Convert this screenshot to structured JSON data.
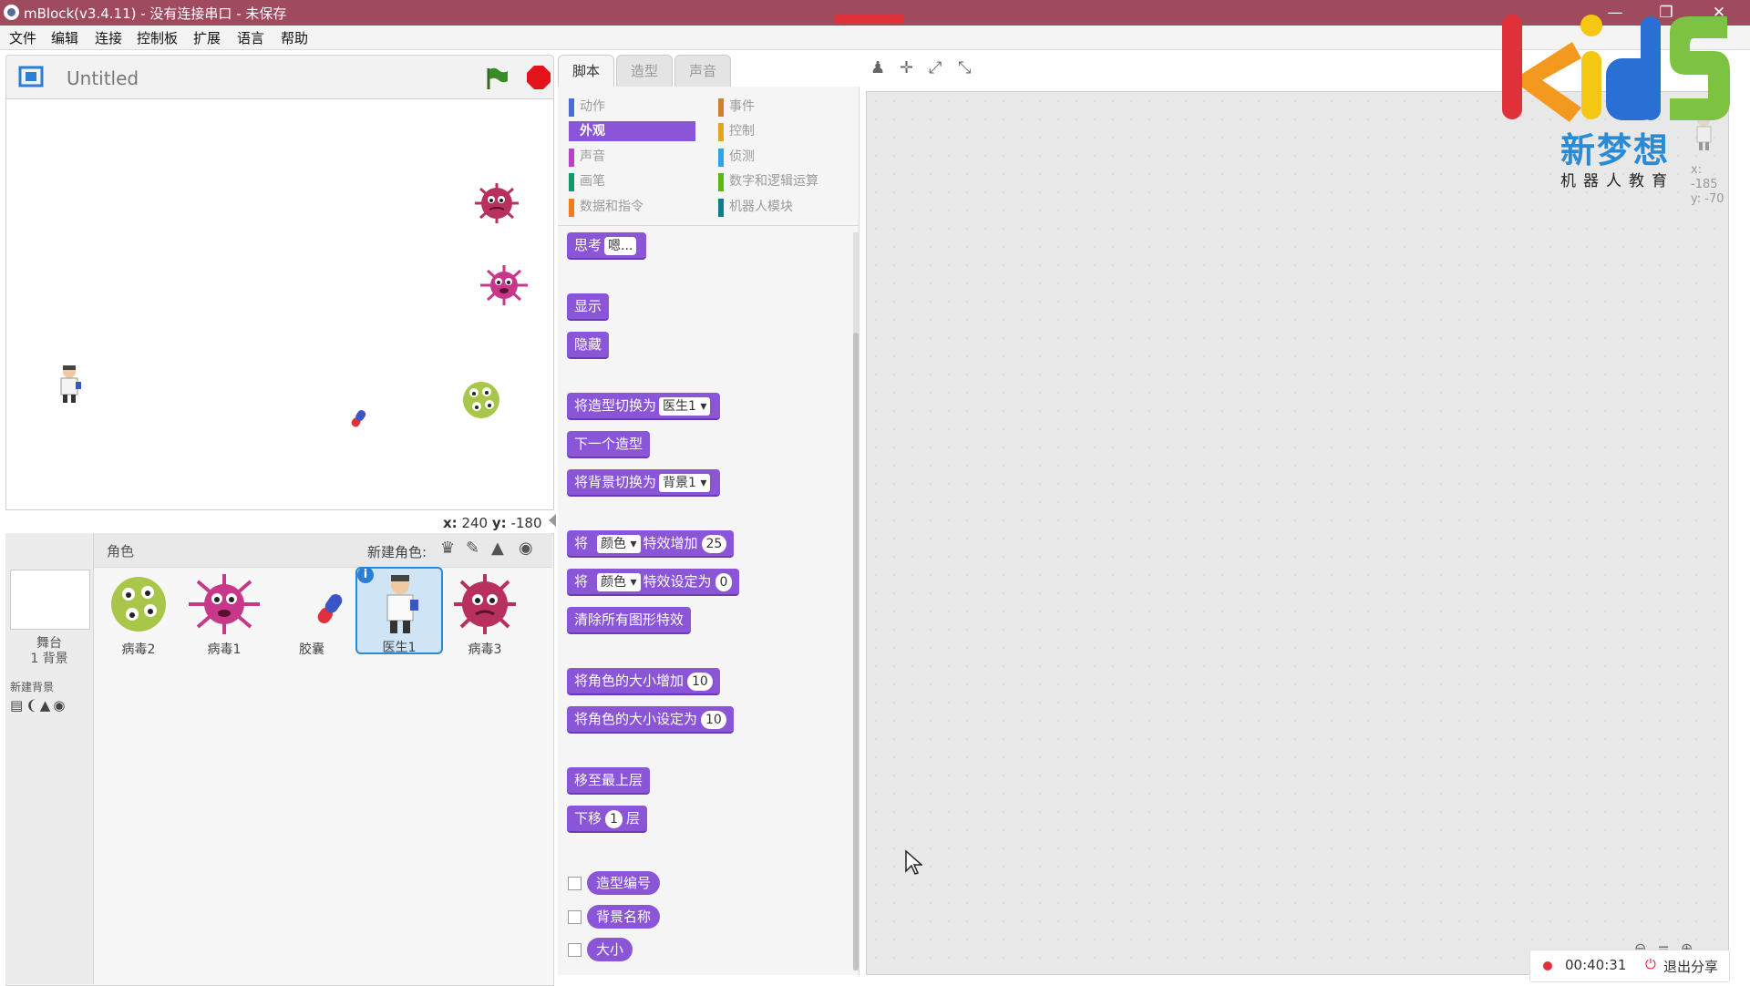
{
  "window": {
    "title": "mBlock(v3.4.11) - 没有连接串口 - 未保存"
  },
  "menu": [
    "文件",
    "编辑",
    "连接",
    "控制板",
    "扩展",
    "语言",
    "帮助"
  ],
  "stage": {
    "title": "Untitled",
    "coords": {
      "x_label": "x:",
      "x": "240",
      "y_label": "y:",
      "y": "-180"
    }
  },
  "sprites_panel": {
    "header": "角色",
    "new_sprite_label": "新建角色:",
    "stage_label": "舞台",
    "stage_backdrops": "1 背景",
    "new_backdrop_label": "新建背景",
    "sprites": [
      {
        "name": "病毒2",
        "color": "#a8c74a"
      },
      {
        "name": "病毒1",
        "color": "#c8388a"
      },
      {
        "name": "胶囊",
        "color": "#3a55c8"
      },
      {
        "name": "医生1",
        "color": "#ffffff",
        "selected": true
      },
      {
        "name": "病毒3",
        "color": "#b8305e"
      }
    ]
  },
  "tabs": [
    "脚本",
    "造型",
    "声音"
  ],
  "categories": [
    {
      "label": "动作",
      "color": "#4a6cd4"
    },
    {
      "label": "外观",
      "color": "#8a55d7",
      "selected": true
    },
    {
      "label": "声音",
      "color": "#bb42c3"
    },
    {
      "label": "画笔",
      "color": "#0e9a6c"
    },
    {
      "label": "数据和指令",
      "color": "#ee7d16"
    },
    {
      "label": "事件",
      "color": "#c88330"
    },
    {
      "label": "控制",
      "color": "#e1a91a"
    },
    {
      "label": "侦测",
      "color": "#2ca5e2"
    },
    {
      "label": "数字和逻辑运算",
      "color": "#5cb712"
    },
    {
      "label": "机器人模块",
      "color": "#0e7e8c"
    }
  ],
  "blocks": {
    "think": {
      "label": "思考",
      "arg": "嗯..."
    },
    "show": "显示",
    "hide": "隐藏",
    "switch_costume": {
      "label": "将造型切换为",
      "arg": "医生1"
    },
    "next_costume": "下一个造型",
    "switch_backdrop": {
      "label": "将背景切换为",
      "arg": "背景1"
    },
    "change_effect": {
      "pre": "将",
      "effect": "颜色",
      "label": "特效增加",
      "arg": "25"
    },
    "set_effect": {
      "pre": "将",
      "effect": "颜色",
      "label": "特效设定为",
      "arg": "0"
    },
    "clear_effects": "清除所有图形特效",
    "change_size": {
      "label": "将角色的大小增加",
      "arg": "10"
    },
    "set_size": {
      "label": "将角色的大小设定为",
      "arg": "10"
    },
    "front": "移至最上层",
    "back": {
      "pre": "下移",
      "arg": "1",
      "post": "层"
    },
    "reporters": [
      "造型编号",
      "背景名称",
      "大小"
    ]
  },
  "script_area": {
    "coords": {
      "x": "x: -185",
      "y": "y: -70"
    },
    "recording_time": "00:40:31",
    "exit_share": "退出分享"
  },
  "logo": {
    "brand": "kids",
    "cn_name": "新梦想",
    "cn_sub": "机器人教育"
  }
}
